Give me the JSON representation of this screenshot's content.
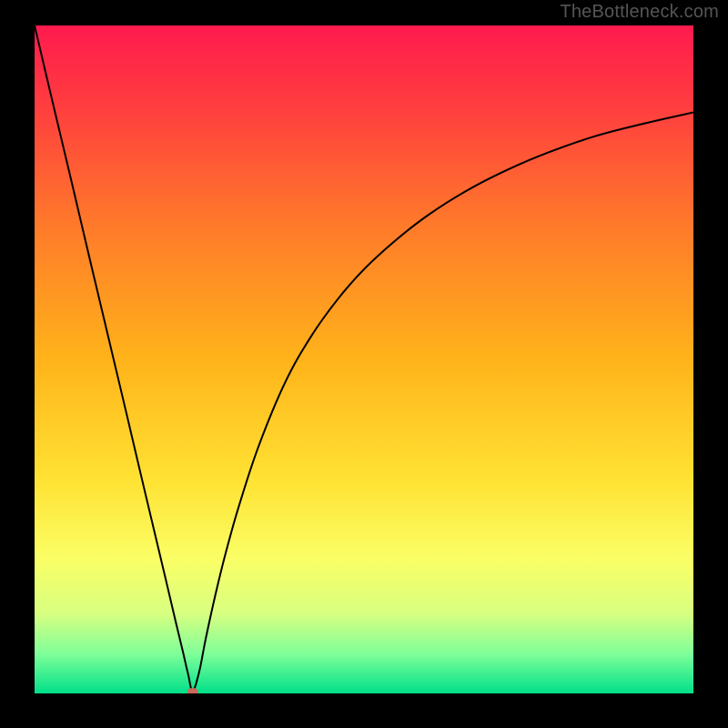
{
  "watermark": "TheBottleneck.com",
  "chart_data": {
    "type": "line",
    "title": "",
    "xlabel": "",
    "ylabel": "",
    "xlim": [
      0,
      100
    ],
    "ylim": [
      0,
      100
    ],
    "grid": false,
    "legend": false,
    "background_gradient": {
      "stops": [
        {
          "offset": 0.0,
          "color": "#ff1a4e"
        },
        {
          "offset": 0.12,
          "color": "#ff3d3f"
        },
        {
          "offset": 0.3,
          "color": "#ff7a2a"
        },
        {
          "offset": 0.5,
          "color": "#ffb31a"
        },
        {
          "offset": 0.68,
          "color": "#ffe233"
        },
        {
          "offset": 0.8,
          "color": "#faff66"
        },
        {
          "offset": 0.88,
          "color": "#d8ff80"
        },
        {
          "offset": 0.94,
          "color": "#80ff99"
        },
        {
          "offset": 1.0,
          "color": "#00e08a"
        }
      ]
    },
    "series": [
      {
        "name": "bottleneck-curve",
        "color": "#000000",
        "width": 2,
        "x": [
          0.0,
          2.0,
          4.0,
          6.0,
          8.0,
          10.0,
          12.0,
          14.0,
          16.0,
          18.0,
          20.0,
          21.5,
          22.5,
          23.3,
          24.0,
          25.0,
          26.0,
          27.5,
          29.0,
          31.0,
          34.0,
          38.0,
          42.0,
          46.0,
          50.0,
          55.0,
          60.0,
          66.0,
          72.0,
          78.0,
          85.0,
          92.0,
          100.0
        ],
        "y": [
          100.0,
          91.6,
          83.3,
          75.0,
          66.6,
          58.3,
          50.0,
          41.7,
          33.3,
          25.0,
          16.7,
          10.4,
          6.3,
          2.9,
          0.4,
          3.3,
          8.3,
          15.0,
          21.0,
          28.0,
          37.0,
          46.5,
          53.5,
          59.0,
          63.5,
          68.0,
          71.8,
          75.5,
          78.5,
          81.0,
          83.4,
          85.2,
          87.0
        ]
      }
    ],
    "marker": {
      "name": "optimum-marker",
      "x": 24.0,
      "y": 0.0,
      "color": "#c86a5a",
      "rx": 6,
      "ry": 4
    }
  }
}
